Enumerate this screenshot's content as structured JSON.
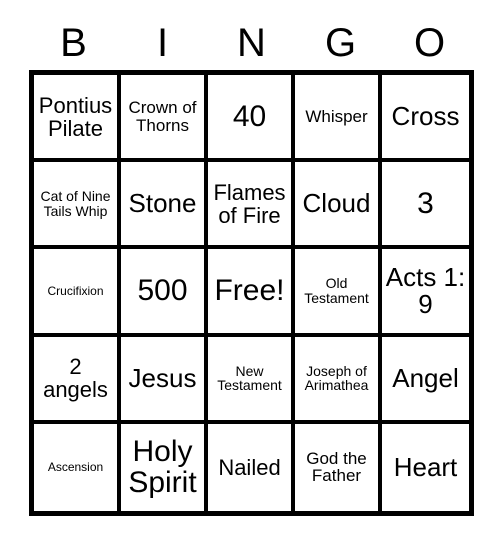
{
  "header": {
    "letters": [
      "B",
      "I",
      "N",
      "G",
      "O"
    ]
  },
  "colors": {
    "grid_line": "#000000",
    "cell_background": "#ffffff",
    "text": "#000000",
    "page_background": "#ffffff"
  },
  "grid": {
    "columns": 5,
    "rows": 5,
    "free_space_index": 12,
    "cells": [
      {
        "text": "Pontius Pilate",
        "size": "md"
      },
      {
        "text": "Crown of Thorns",
        "size": "sm"
      },
      {
        "text": "40",
        "size": "xl"
      },
      {
        "text": "Whisper",
        "size": "sm"
      },
      {
        "text": "Cross",
        "size": "lg"
      },
      {
        "text": "Cat of Nine Tails Whip",
        "size": "xs"
      },
      {
        "text": "Stone",
        "size": "lg"
      },
      {
        "text": "Flames of Fire",
        "size": "md"
      },
      {
        "text": "Cloud",
        "size": "lg"
      },
      {
        "text": "3",
        "size": "xl"
      },
      {
        "text": "Crucifixion",
        "size": "xxs"
      },
      {
        "text": "500",
        "size": "xl"
      },
      {
        "text": "Free!",
        "size": "xl"
      },
      {
        "text": "Old Testament",
        "size": "xs"
      },
      {
        "text": "Acts 1: 9",
        "size": "lg"
      },
      {
        "text": "2 angels",
        "size": "md"
      },
      {
        "text": "Jesus",
        "size": "lg"
      },
      {
        "text": "New Testament",
        "size": "xs"
      },
      {
        "text": "Joseph of Arimathea",
        "size": "xs"
      },
      {
        "text": "Angel",
        "size": "lg"
      },
      {
        "text": "Ascension",
        "size": "xxs"
      },
      {
        "text": "Holy Spirit",
        "size": "xl"
      },
      {
        "text": "Nailed",
        "size": "md"
      },
      {
        "text": "God the Father",
        "size": "sm"
      },
      {
        "text": "Heart",
        "size": "lg"
      }
    ]
  }
}
